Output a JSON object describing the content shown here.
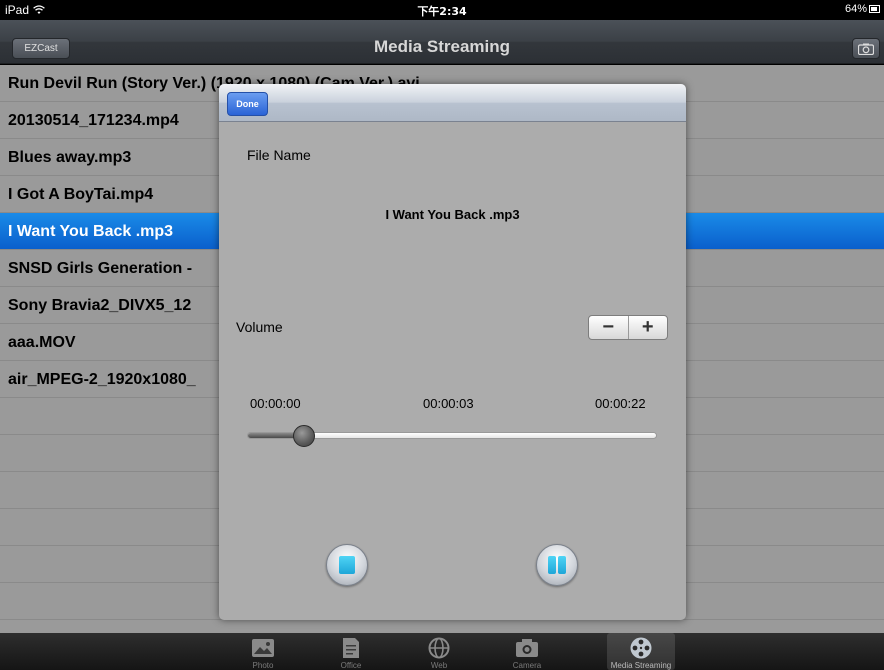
{
  "status_bar": {
    "device": "iPad",
    "time": "下午2:34",
    "battery": "64%"
  },
  "nav": {
    "title": "Media Streaming",
    "ezcast_label": "EZCast"
  },
  "file_list": [
    "Run Devil Run (Story Ver.) (1920 x 1080) (Cam Ver.).avi",
    "20130514_171234.mp4",
    "Blues away.mp3",
    "I Got A BoyTai.mp4",
    "I Want You Back .mp3",
    "SNSD Girls Generation -",
    "Sony Bravia2_DIVX5_12",
    "aaa.MOV",
    "air_MPEG-2_1920x1080_"
  ],
  "selected_index": 4,
  "modal": {
    "done_label": "Done",
    "file_name_label": "File Name",
    "file_name_value": "I Want You Back .mp3",
    "volume_label": "Volume",
    "volume_minus": "−",
    "volume_plus": "+",
    "time_start": "00:00:00",
    "time_current": "00:00:03",
    "time_end": "00:00:22",
    "progress_fraction": 0.14
  },
  "tabs": [
    {
      "label": "Photo",
      "icon": "photo-icon"
    },
    {
      "label": "Office",
      "icon": "document-icon"
    },
    {
      "label": "Web",
      "icon": "globe-icon"
    },
    {
      "label": "Camera",
      "icon": "camera-icon"
    },
    {
      "label": "Media Streaming",
      "icon": "film-reel-icon",
      "active": true
    }
  ]
}
